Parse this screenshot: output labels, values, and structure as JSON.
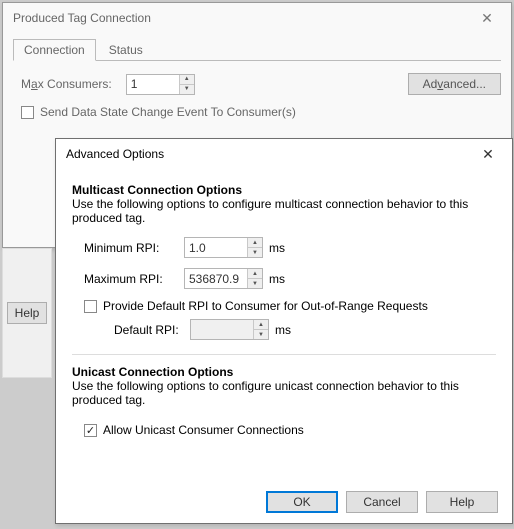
{
  "parent": {
    "title": "Produced Tag Connection",
    "tabs": {
      "connection": "Connection",
      "status": "Status"
    },
    "max_consumers_label_pre": "M",
    "max_consumers_label_und": "a",
    "max_consumers_label_post": "x Consumers:",
    "max_consumers_value": "1",
    "advanced_btn_pre": "Ad",
    "advanced_btn_und": "v",
    "advanced_btn_post": "anced...",
    "send_data_checkbox": "Send Data State Change Event To Consumer(s)",
    "help_btn": "Help"
  },
  "adv": {
    "title": "Advanced Options",
    "multicast_title": "Multicast Connection Options",
    "multicast_desc": "Use the following options to configure multicast connection behavior to this produced tag.",
    "min_rpi_label": "Minimum RPI:",
    "min_rpi_value": "1.0",
    "max_rpi_label": "Maximum RPI:",
    "max_rpi_value": "536870.9",
    "unit_ms": "ms",
    "provide_default_label": "Provide Default RPI to Consumer for Out-of-Range Requests",
    "default_rpi_label": "Default RPI:",
    "default_rpi_value": "",
    "unicast_title": "Unicast Connection Options",
    "unicast_desc": "Use the following options to configure unicast connection behavior to this produced tag.",
    "allow_unicast_label": "Allow Unicast Consumer Connections",
    "allow_unicast_checked": "✓",
    "ok_btn": "OK",
    "cancel_btn": "Cancel",
    "help_btn": "Help"
  }
}
